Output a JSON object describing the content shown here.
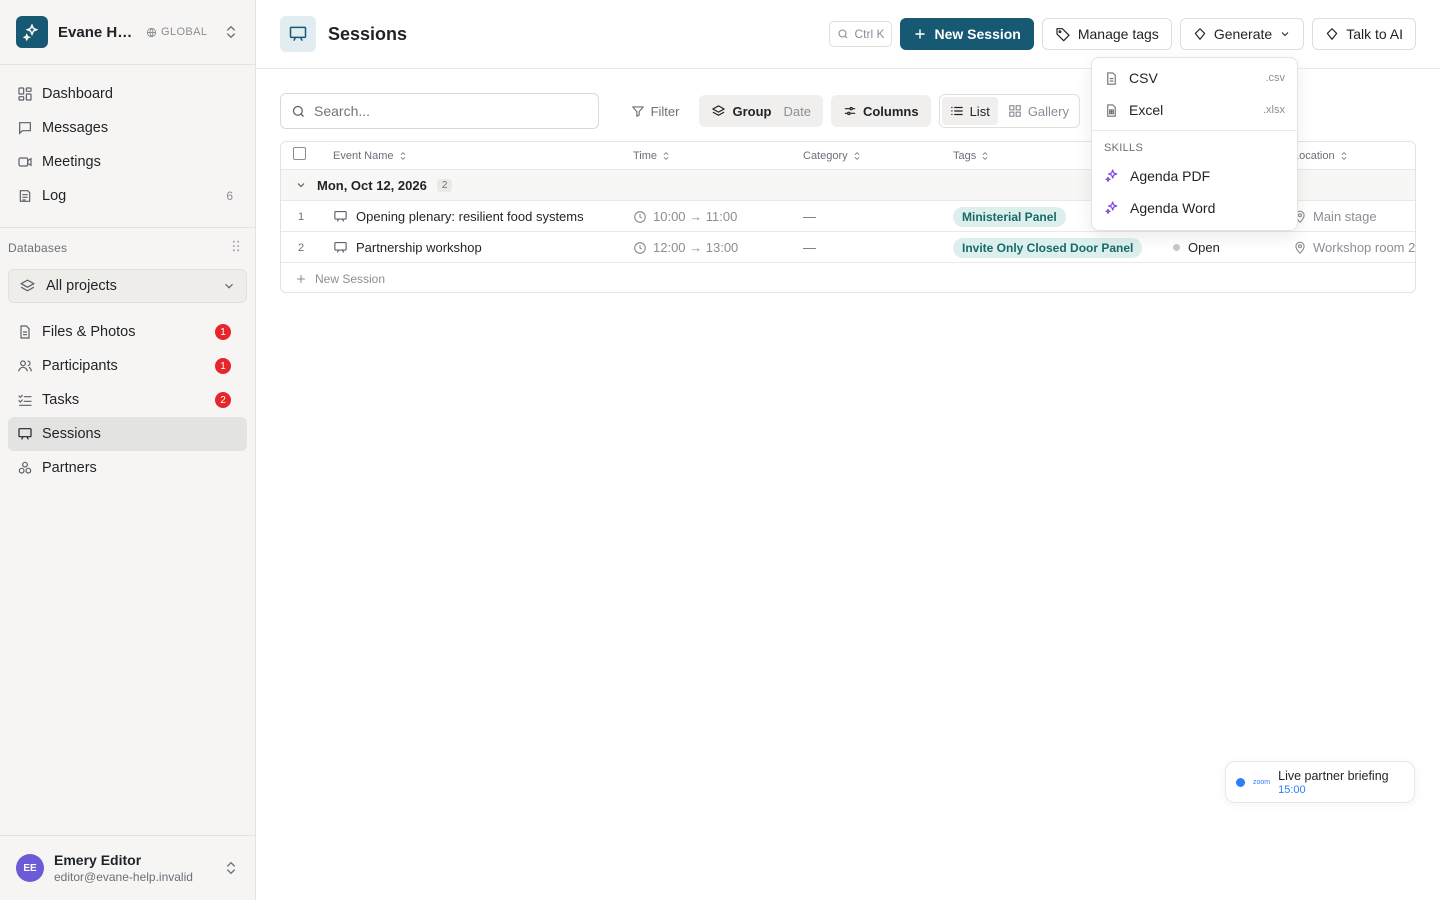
{
  "workspace": {
    "name": "Evane He...",
    "scope": "GLOBAL"
  },
  "nav": [
    {
      "label": "Dashboard",
      "icon": "dashboard-icon"
    },
    {
      "label": "Messages",
      "icon": "message-icon"
    },
    {
      "label": "Meetings",
      "icon": "video-icon"
    },
    {
      "label": "Log",
      "icon": "log-icon",
      "count": "6"
    }
  ],
  "databases_label": "Databases",
  "project_select": "All projects",
  "db_items": [
    {
      "label": "Files & Photos",
      "badge": "1"
    },
    {
      "label": "Participants",
      "badge": "1"
    },
    {
      "label": "Tasks",
      "badge": "2"
    },
    {
      "label": "Sessions"
    },
    {
      "label": "Partners"
    }
  ],
  "user": {
    "initials": "EE",
    "name": "Emery Editor",
    "email": "editor@evane-help.invalid"
  },
  "header": {
    "title": "Sessions",
    "shortcut": "Ctrl K",
    "new_session": "New Session",
    "manage_tags": "Manage tags",
    "generate": "Generate",
    "talk_ai": "Talk to AI"
  },
  "toolbar": {
    "search_placeholder": "Search...",
    "filter": "Filter",
    "group": "Group",
    "group_value": "Date",
    "columns": "Columns",
    "view_list": "List",
    "view_gallery": "Gallery"
  },
  "table": {
    "columns": [
      "Event Name",
      "Time",
      "Category",
      "Tags",
      "Location"
    ],
    "group": {
      "label": "Mon, Oct 12, 2026",
      "count": "2"
    },
    "rows": [
      {
        "idx": "1",
        "name": "Opening plenary: resilient food systems",
        "time": "10:00 → 11:00",
        "category": "—",
        "tag": "Ministerial Panel",
        "status": "",
        "location": "Main stage"
      },
      {
        "idx": "2",
        "name": "Partnership workshop",
        "time": "12:00 → 13:00",
        "category": "—",
        "tag": "Invite Only Closed Door Panel",
        "status": "Open",
        "location": "Workshop room 2"
      }
    ],
    "new_row": "New Session"
  },
  "generate_menu": {
    "items": [
      {
        "label": "CSV",
        "ext": ".csv"
      },
      {
        "label": "Excel",
        "ext": ".xlsx"
      }
    ],
    "skills_label": "SKILLS",
    "skills": [
      "Agenda PDF",
      "Agenda Word"
    ]
  },
  "floating": {
    "brand": "zoom",
    "title": "Live partner briefing",
    "time": "15:00"
  },
  "colors": {
    "accent": "#175873",
    "badge": "#e5262b",
    "tag_bg": "#dcefed",
    "tag_text": "#176a6a",
    "skill": "#7c4ddb",
    "zoom": "#2d7ff9"
  }
}
